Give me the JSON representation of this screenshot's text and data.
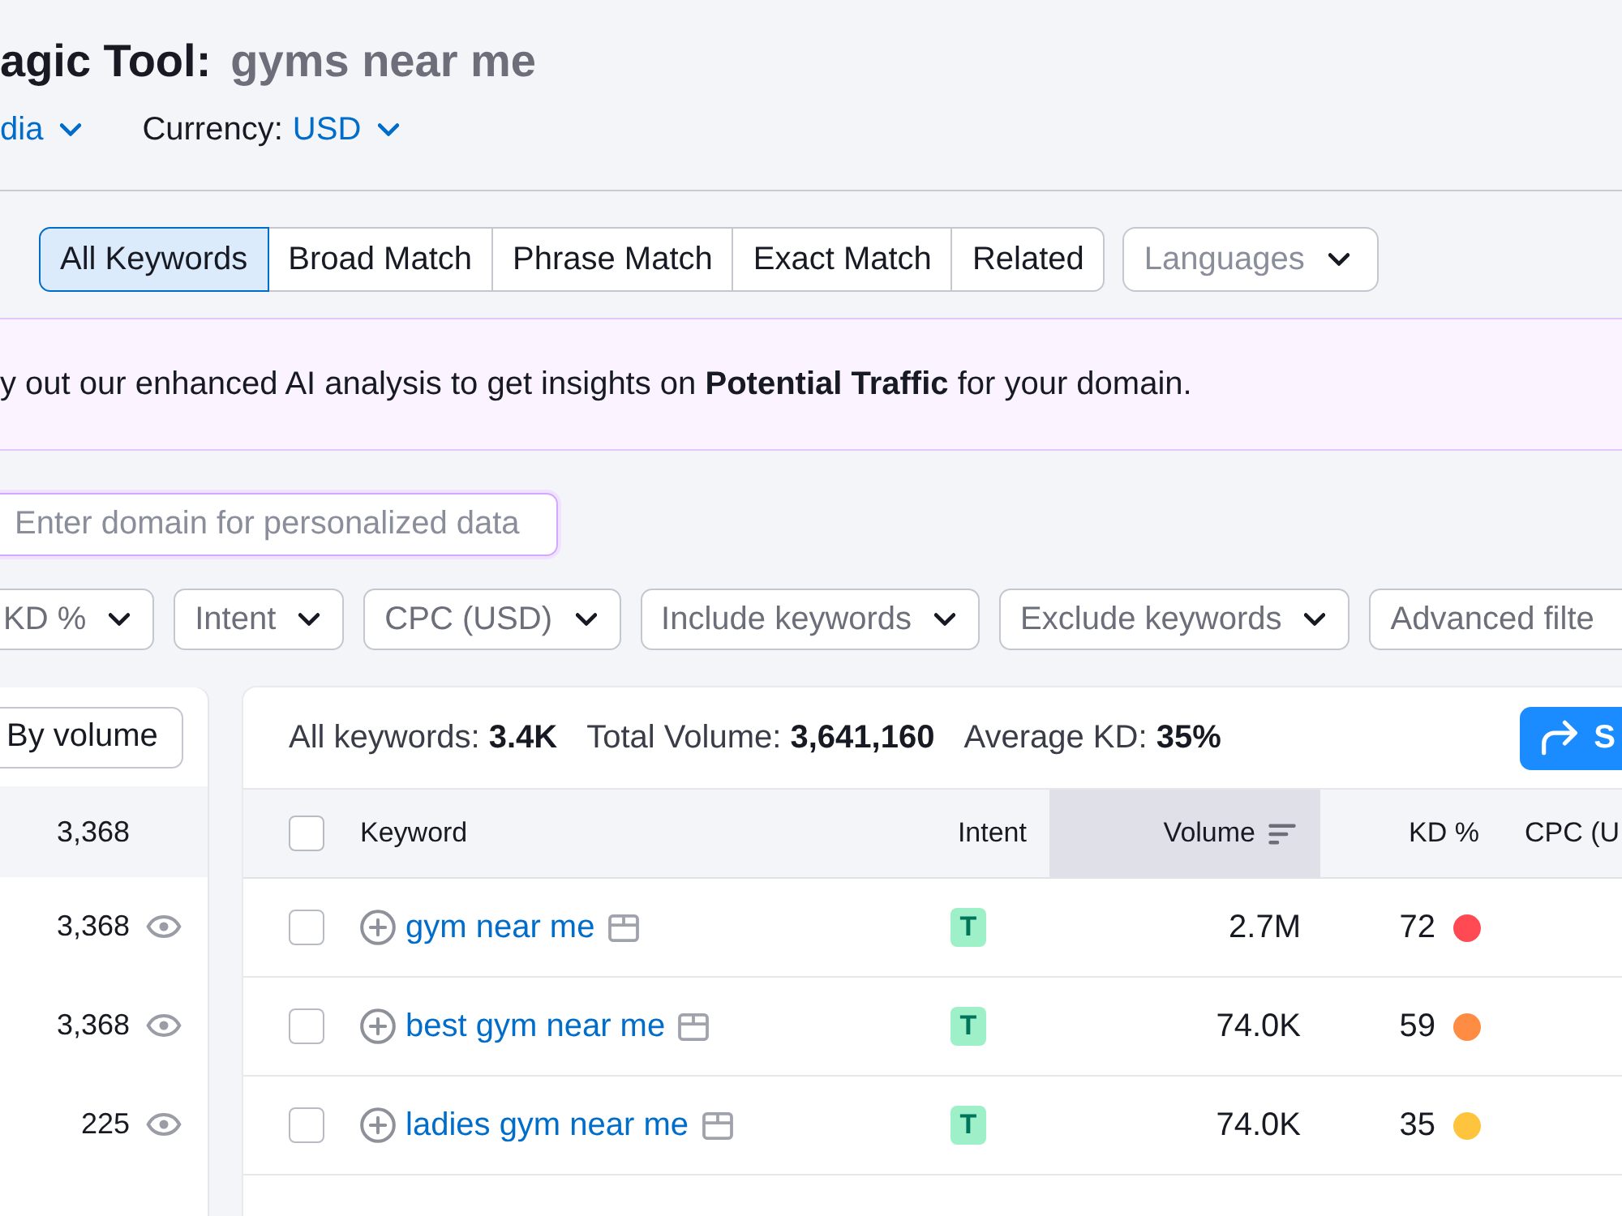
{
  "page_title": {
    "title": "agic Tool:",
    "query": "gyms near me"
  },
  "selectors": [
    {
      "value": "dia"
    },
    {
      "label": "Currency:",
      "value": "USD"
    }
  ],
  "match_tabs": [
    {
      "label": "All Keywords",
      "selected": true
    },
    {
      "label": "Broad Match",
      "selected": false
    },
    {
      "label": "Phrase Match",
      "selected": false
    },
    {
      "label": "Exact Match",
      "selected": false
    },
    {
      "label": "Related",
      "selected": false
    }
  ],
  "language_select": {
    "placeholder": "Languages"
  },
  "banner": {
    "text": "y out our enhanced AI analysis to get insights on **Potential Traffic** for your domain."
  },
  "domain_input": {
    "placeholder": "Enter domain for personalized data"
  },
  "filters": [
    {
      "label": "KD %",
      "chevron": true
    },
    {
      "label": "Intent",
      "chevron": true
    },
    {
      "label": "CPC (USD)",
      "chevron": true
    },
    {
      "label": "Include keywords",
      "chevron": true
    },
    {
      "label": "Exclude keywords",
      "chevron": true
    },
    {
      "label": "Advanced filte",
      "chevron": false
    }
  ],
  "groups_panel": {
    "sort_button": "By volume",
    "groups": [
      {
        "kind": "total",
        "count": "3,368"
      },
      {
        "kind": "group",
        "count": "3,368"
      },
      {
        "kind": "group",
        "count": "3,368"
      },
      {
        "kind": "group",
        "count": "225"
      }
    ]
  },
  "summary": [
    "All keywords: **3.4K**",
    "Total Volume: **3,641,160**",
    "Average KD: **35%**"
  ],
  "action_button": {
    "label": "S"
  },
  "table": {
    "select_all_checked": false,
    "columns": [
      {
        "label": "Keyword",
        "sorted": false
      },
      {
        "label": "Intent",
        "sorted": false
      },
      {
        "label": "Volume",
        "sorted": true
      },
      {
        "label": "KD %",
        "sorted": false
      },
      {
        "label": "CPC (U",
        "sorted": false
      }
    ],
    "rows": [
      {
        "checked": false,
        "keyword": "gym near me",
        "intent": "T",
        "volume": "2.7M",
        "kd": {
          "value": "72",
          "color": "#ff4953"
        }
      },
      {
        "checked": false,
        "keyword": "best gym near me",
        "intent": "T",
        "volume": "74.0K",
        "kd": {
          "value": "59",
          "color": "#ff8c43"
        }
      },
      {
        "checked": false,
        "keyword": "ladies gym near me",
        "intent": "T",
        "volume": "74.0K",
        "kd": {
          "value": "35",
          "color": "#ffc43d"
        }
      }
    ]
  }
}
